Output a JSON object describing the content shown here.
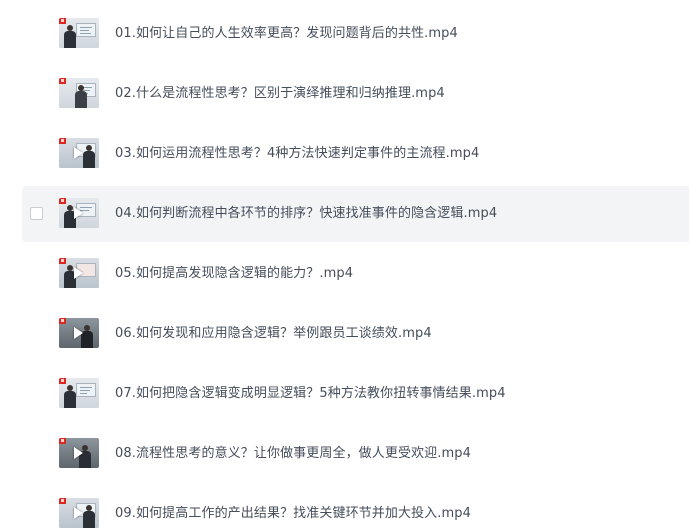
{
  "files": [
    {
      "name": "01.如何让自己的人生效率更高？发现问题背后的共性.mp4",
      "thumbnail": "video-thumbnail",
      "has_play_icon": false
    },
    {
      "name": "02.什么是流程性思考？区别于演绎推理和归纳推理.mp4",
      "thumbnail": "video-thumbnail",
      "has_play_icon": false
    },
    {
      "name": "03.如何运用流程性思考？4种方法快速判定事件的主流程.mp4",
      "thumbnail": "video-thumbnail",
      "has_play_icon": true
    },
    {
      "name": "04.如何判断流程中各环节的排序？快速找准事件的隐含逻辑.mp4",
      "thumbnail": "video-thumbnail",
      "has_play_icon": true,
      "hovered": true
    },
    {
      "name": "05.如何提高发现隐含逻辑的能力？.mp4",
      "thumbnail": "video-thumbnail",
      "has_play_icon": true
    },
    {
      "name": "06.如何发现和应用隐含逻辑？举例跟员工谈绩效.mp4",
      "thumbnail": "video-thumbnail",
      "has_play_icon": true
    },
    {
      "name": "07.如何把隐含逻辑变成明显逻辑？5种方法教你扭转事情结果.mp4",
      "thumbnail": "video-thumbnail",
      "has_play_icon": false
    },
    {
      "name": "08.流程性思考的意义？让你做事更周全，做人更受欢迎.mp4",
      "thumbnail": "video-thumbnail",
      "has_play_icon": true
    },
    {
      "name": "09.如何提高工作的产出结果？找准关键环节并加大投入.mp4",
      "thumbnail": "video-thumbnail",
      "has_play_icon": true
    }
  ],
  "colors": {
    "text": "#454d5a",
    "hover_bg": "#f3f4f6",
    "brand_red": "#d8281f"
  }
}
